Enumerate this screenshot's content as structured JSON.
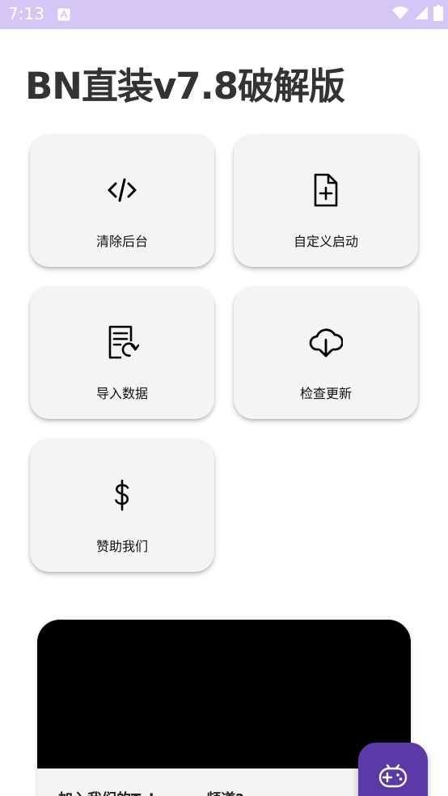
{
  "status_bar": {
    "time": "7:13",
    "icons": [
      "notification-a-icon",
      "wifi-icon",
      "signal-icon",
      "battery-icon"
    ],
    "background": "#d6c6f5"
  },
  "app": {
    "title": "BN直装v7.8破解版"
  },
  "tiles": [
    {
      "label": "清除后台",
      "icon": "code-icon"
    },
    {
      "label": "自定义启动",
      "icon": "file-add-icon"
    },
    {
      "label": "导入数据",
      "icon": "document-sync-icon"
    },
    {
      "label": "检查更新",
      "icon": "cloud-download-icon"
    },
    {
      "label": "赞助我们",
      "icon": "dollar-icon"
    }
  ],
  "card": {
    "text": "加入我们的Telegram频道?"
  },
  "fab": {
    "icon": "gamepad-icon",
    "color": "#5b3aa8"
  }
}
